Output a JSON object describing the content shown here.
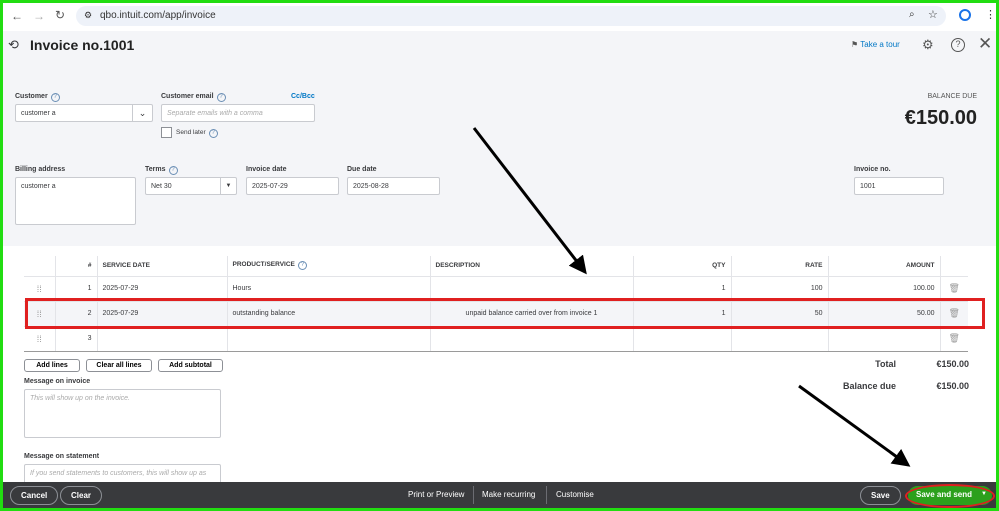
{
  "browser": {
    "url": "qbo.intuit.com/app/invoice"
  },
  "header": {
    "title": "Invoice no.1001",
    "take_tour": "Take a tour"
  },
  "form": {
    "customer_label": "Customer",
    "customer_value": "customer a",
    "email_label": "Customer email",
    "email_placeholder": "Separate emails with a comma",
    "cc_bcc": "Cc/Bcc",
    "send_later": "Send later",
    "balance_due_label": "BALANCE DUE",
    "balance_due_value": "€150.00",
    "billing_label": "Billing address",
    "billing_value": "customer a",
    "terms_label": "Terms",
    "terms_value": "Net 30",
    "invoice_date_label": "Invoice date",
    "invoice_date_value": "2025-07-29",
    "due_date_label": "Due date",
    "due_date_value": "2025-08-28",
    "invoice_no_label": "Invoice no.",
    "invoice_no_value": "1001"
  },
  "table": {
    "headers": [
      "#",
      "SERVICE DATE",
      "PRODUCT/SERVICE",
      "DESCRIPTION",
      "QTY",
      "RATE",
      "AMOUNT"
    ],
    "rows": [
      {
        "num": "1",
        "date": "2025-07-29",
        "product": "Hours",
        "description": "",
        "qty": "1",
        "rate": "100",
        "amount": "100.00"
      },
      {
        "num": "2",
        "date": "2025-07-29",
        "product": "outstanding balance",
        "description": "unpaid balance carried over from invoice 1",
        "qty": "1",
        "rate": "50",
        "amount": "50.00"
      },
      {
        "num": "3",
        "date": "",
        "product": "",
        "description": "",
        "qty": "",
        "rate": "",
        "amount": ""
      }
    ]
  },
  "actions": {
    "add_lines": "Add lines",
    "clear_all": "Clear all lines",
    "add_subtotal": "Add subtotal"
  },
  "messages": {
    "invoice_label": "Message on invoice",
    "invoice_placeholder": "This will show up on the invoice.",
    "statement_label": "Message on statement",
    "statement_placeholder": "If you send statements to customers, this will show up as"
  },
  "totals": {
    "total_label": "Total",
    "total_value": "€150.00",
    "balance_label": "Balance due",
    "balance_value": "€150.00"
  },
  "footer": {
    "cancel": "Cancel",
    "clear": "Clear",
    "print": "Print or Preview",
    "recurring": "Make recurring",
    "customise": "Customise",
    "save": "Save",
    "save_send": "Save and send"
  },
  "colors": {
    "highlight": "#e02020",
    "frame": "#22dd11",
    "primary": "#2ca01c",
    "footer": "#393a3d"
  }
}
